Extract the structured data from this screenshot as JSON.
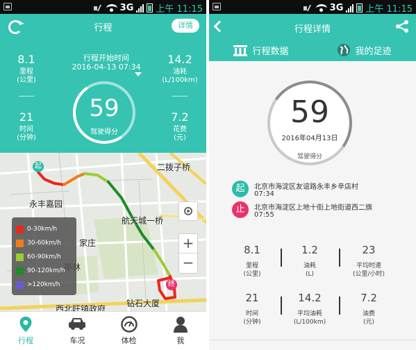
{
  "status_bar": {
    "network": "3G",
    "time": "上午 11:15"
  },
  "left": {
    "title": "行程",
    "detail_button": "详情",
    "start_label": "行程开始时间",
    "start_time": "2016-04-13 07:34",
    "score": "59",
    "score_label": "驾驶得分",
    "stats": {
      "mileage_value": "8.1",
      "mileage_label": "里程",
      "mileage_unit": "(公里)",
      "fuel_value": "14.2",
      "fuel_label": "油耗",
      "fuel_unit": "(L/100km)",
      "time_value": "21",
      "time_label": "时间",
      "time_unit": "(分钟)",
      "cost_value": "7.2",
      "cost_label": "花费",
      "cost_unit": "(元)"
    },
    "map": {
      "labels": {
        "erbozi": "二拨子桥",
        "yongfeng": "永丰嘉园",
        "hangtian": "航天城一桥",
        "jiazhuang": "家庄",
        "tinglin": "亭林",
        "zuanshi": "钻石大厦",
        "xibeiwang": "西北旺镇政府"
      },
      "start_pin": "起",
      "end_pin": "终",
      "zoom_in": "+",
      "zoom_out": "−",
      "legend": [
        {
          "label": "0-30km/h",
          "color": "#e8271f"
        },
        {
          "label": "30-60km/h",
          "color": "#f07c1c"
        },
        {
          "label": "60-90km/h",
          "color": "#9acd32"
        },
        {
          "label": "90-120km/h",
          "color": "#1f8a2a"
        },
        {
          "label": ">120km/h",
          "color": "#6b5bd0"
        }
      ]
    },
    "nav": [
      {
        "label": "行程",
        "icon": "location-pin-icon"
      },
      {
        "label": "车况",
        "icon": "car-icon"
      },
      {
        "label": "体检",
        "icon": "gauge-icon"
      },
      {
        "label": "我",
        "icon": "person-icon"
      }
    ]
  },
  "right": {
    "title": "行程详情",
    "tabs": {
      "data_label": "行程数据",
      "footprint_label": "我的足迹"
    },
    "score": "59",
    "date": "2016年04月13日",
    "score_label": "驾驶得分",
    "start_badge": "起",
    "start_address": "北京市海淀区友谊路永丰乡辛店村",
    "start_time": "07:34",
    "end_badge": "止",
    "end_address": "北京市海淀区上地十街上地街道西二旗",
    "end_time": "07:55",
    "stats": [
      {
        "value": "8.1",
        "label": "里程",
        "unit": "(公里)"
      },
      {
        "value": "1.2",
        "label": "油耗",
        "unit": "(L)"
      },
      {
        "value": "23",
        "label": "平均时速",
        "unit": "(公里/小时)"
      },
      {
        "value": "21",
        "label": "时间",
        "unit": "(分钟)"
      },
      {
        "value": "14.2",
        "label": "平均油耗",
        "unit": "(L/100km)"
      },
      {
        "value": "7.2",
        "label": "油费",
        "unit": "(元)"
      }
    ],
    "colors": {
      "accent": "#36c3b1",
      "start": "#2bbba6",
      "end": "#e8336b"
    }
  }
}
